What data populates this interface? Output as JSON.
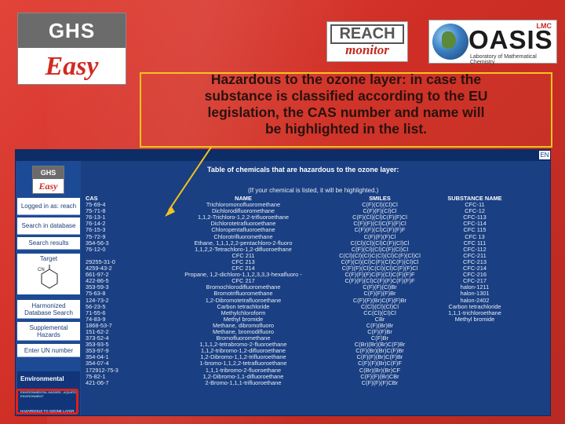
{
  "logos": {
    "ghs_top": "GHS",
    "ghs_bottom": "Easy",
    "reach_top": "REACH",
    "reach_bottom": "monitor",
    "oasis_word": "OASIS",
    "oasis_badge": "LMC",
    "oasis_sub": "Laboratory of Mathematical Chemistry"
  },
  "callout": {
    "lines": [
      "Hazardous to the ozone layer: in case the",
      "substance is classified according to the EU",
      "legislation, the CAS number and name will",
      "be highlighted in the list."
    ],
    "border_color": "#f3c31d"
  },
  "app": {
    "topbar_cue": "EN",
    "sidebar": {
      "logo_top": "GHS",
      "logo_bottom": "Easy",
      "logged_in": "Logged in as: reach",
      "search_db": "Search in database",
      "search_results": "Search results",
      "target": "Target",
      "harmonized": "Harmonized Database Search",
      "supplemental": "Supplemental Hazards",
      "enter_un": "Enter UN number",
      "environmental": "Environmental",
      "env_sub": "ENVIRONMENTAL HAZARD - AQUATIC ENVIRONMENT",
      "ozone_link": "HAZARDOUS TO OZONE LAYER"
    },
    "table": {
      "title": "Table of chemicals that are hazardous to the ozone layer:",
      "note": "(If your chemical is listed, it will be highlighted.)",
      "headers": {
        "cas": "CAS",
        "name": "NAME",
        "smiles": "SMILES",
        "substance": "SUBSTANCE NAME"
      },
      "rows": [
        [
          "75-69-4",
          "Trichloromonofluoromethane",
          "C(F)(Cl)(Cl)Cl",
          "CFC-11"
        ],
        [
          "75-71-8",
          "Dichlorodifluoromethane",
          "C(F)(F)(Cl)Cl",
          "CFC-12"
        ],
        [
          "76-13-1",
          "1,1,2-Trichloro-1,2,2-trifluoroethane",
          "C(F)(Cl)(Cl)C(F)(F)Cl",
          "CFC-113"
        ],
        [
          "76-14-2",
          "Dichlorotetrafluoroethane",
          "C(F)(F)(Cl)C(F)(F)Cl",
          "CFC-114"
        ],
        [
          "76-15-3",
          "Chloropentafluoroethane",
          "C(F)(F)(Cl)C(F)(F)F",
          "CFC 115"
        ],
        [
          "75-72-9",
          "Chlorotrifluoromethane",
          "C(F)(F)(F)Cl",
          "CFC 13"
        ],
        [
          "354-56-3",
          "Ethane, 1,1,1,2,2-pentachloro-2-fluoro",
          "C(Cl)(Cl)(Cl)C(F)(Cl)Cl",
          "CFC 111"
        ],
        [
          "76-12-0",
          "1,1,2,2-Tetrachloro-1,2-difluoroethane",
          "C(F)(Cl)(Cl)C(F)(Cl)Cl",
          "CFC-112"
        ],
        [
          "",
          "CFC 211",
          "C(Cl)(Cl)(Cl)C(Cl)(Cl)C(F)(Cl)Cl",
          "CFC-211"
        ],
        [
          "29255-31-0",
          "CFC 213",
          "C(F)(Cl)(Cl)C(F)(Cl)C(F)(Cl)Cl",
          "CFC-213"
        ],
        [
          "4259-43-2",
          "CFC 214",
          "C(F)(F)(Cl)C(Cl)(Cl)C(F)(F)Cl",
          "CFC-214"
        ],
        [
          "661-97-2",
          "Propane, 1,2-dichloro-1,1,2,3,3,3-hexafluoro -",
          "C(F)(F)(F)C(F)(Cl)C(F)(F)F",
          "CFC-216"
        ],
        [
          "422-86-5",
          "CFC 217",
          "C(F)(F)(Cl)C(F)(F)C(F)(F)F",
          "CFC-217"
        ],
        [
          "353-59-3",
          "Bromochlorodifluoromethane",
          "C(F)(F)(Cl)Br",
          "halon-1211"
        ],
        [
          "75-63-8",
          "Bromotrifluoromethane",
          "C(F)(F)(F)Br",
          "halon-1301"
        ],
        [
          "124-73-2",
          "1,2-Dibromotetrafluoroethane",
          "C(F)(F)(Br)C(F)(F)Br",
          "halon-2402"
        ],
        [
          "56-23-5",
          "Carbon tetrachloride",
          "C(Cl)(Cl)(Cl)Cl",
          "Carbon tetrachloride"
        ],
        [
          "71-55-6",
          "Methylchloroform",
          "CC(Cl)(Cl)Cl",
          "1,1,1-trichloroethane"
        ],
        [
          "74-83-9",
          "Methyl bromide",
          "CBr",
          "Methyl bromide"
        ],
        [
          "1868-53-7",
          "Methane, dibromofluoro",
          "C(F)(Br)Br",
          ""
        ],
        [
          "151-62-2",
          "Methane, bromodifluoro",
          "C(F)(F)Br",
          ""
        ],
        [
          "373-52-4",
          "Bromofluoromethane",
          "C(F)Br",
          ""
        ],
        [
          "353-93-5",
          "1,1,1,2-tetrabromo-2-fluoroethane",
          "C(Br)(Br)(Br)C(F)Br",
          ""
        ],
        [
          "353-97-9",
          "1,1,2-tribromo-1,2-difluoroethane",
          "C(F)(Br)(Br)C(F)Br",
          ""
        ],
        [
          "354-04-1",
          "1,2-Dibromo-1,1,2-trifluoroethane",
          "C(F)(F)(Br)C(F)Br",
          ""
        ],
        [
          "354-07-4",
          "1-bromo-1,1,2,2-tetrafluoroethane",
          "C(F)(F)(Br)C(F)F",
          ""
        ],
        [
          "172912-75-3",
          "1,1,1-tribromo-2-fluoroethane",
          "C(Br)(Br)(Br)CF",
          ""
        ],
        [
          "75-82-1",
          "1,2-Dibromo-1,1-difluoroethane",
          "C(F)(F)(Br)CBr",
          ""
        ],
        [
          "421-06-7",
          "2-Bromo-1,1,1-trifluoroethane",
          "C(F)(F)(F)CBr",
          ""
        ]
      ]
    }
  }
}
